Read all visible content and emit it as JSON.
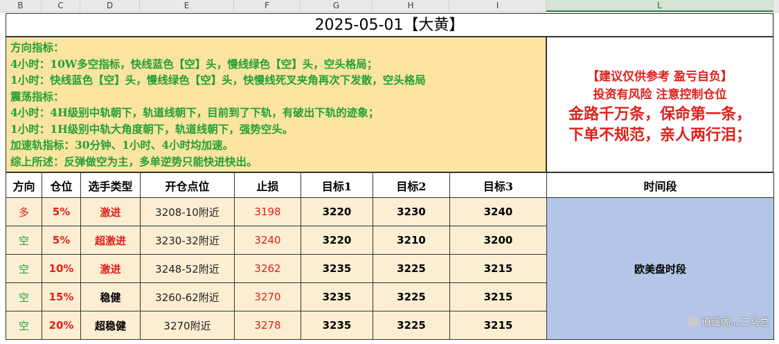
{
  "column_headers": [
    "B",
    "C",
    "D",
    "E",
    "F",
    "G",
    "H",
    "I",
    "L"
  ],
  "title": "2025-05-01【大黄】",
  "analysis_lines": [
    "方向指标：",
    "4小时：10W多空指标，快线蓝色【空】头，慢线绿色【空】头，空头格局；",
    "1小时：快线蓝色【空】头，慢线绿色【空】头，快慢线死叉夹角再次下发散，空头格局",
    "震荡指标：",
    "4小时：4H级别中轨朝下，轨道线朝下，目前到了下轨，有破出下轨的迹象；",
    "1小时：1H级别中轨大角度朝下，轨道线朝下，强势空头。",
    "加速轨指标：30分钟、1小时、4小时均加速。",
    "综上所述：反弹做空为主，多单逆势只能快进快出。"
  ],
  "risk_notes": [
    "【建议仅供参考 盈亏自负】",
    "投资有风险 注意控制仓位",
    "金路千万条，保命第一条，",
    "下单不规范，亲人两行泪；"
  ],
  "table": {
    "headers": [
      "方向",
      "仓位",
      "选手类型",
      "开仓点位",
      "止损",
      "目标1",
      "目标2",
      "目标3",
      "时间段"
    ],
    "rows": [
      {
        "direction": "多",
        "position": "5%",
        "type": "激进",
        "entry": "3208-10附近",
        "stop": "3198",
        "t1": "3220",
        "t2": "3230",
        "t3": "3240"
      },
      {
        "direction": "空",
        "position": "5%",
        "type": "超激进",
        "entry": "3230-32附近",
        "stop": "3240",
        "t1": "3220",
        "t2": "3210",
        "t3": "3200"
      },
      {
        "direction": "空",
        "position": "10%",
        "type": "激进",
        "entry": "3248-52附近",
        "stop": "3262",
        "t1": "3235",
        "t2": "3225",
        "t3": "3215"
      },
      {
        "direction": "空",
        "position": "15%",
        "type": "稳健",
        "entry": "3260-62附近",
        "stop": "3270",
        "t1": "3235",
        "t2": "3225",
        "t3": "3215"
      },
      {
        "direction": "空",
        "position": "20%",
        "type": "超稳健",
        "entry": "3270附近",
        "stop": "3278",
        "t1": "3235",
        "t2": "3225",
        "t3": "3215"
      }
    ],
    "session": "欧美盘时段"
  },
  "watermark": "道遥阁灬二马总",
  "colors": {
    "info_bg": "#fbe3a0",
    "row_bg": "#fbeed2",
    "session_bg": "#b4c6e7",
    "red": "#e0201b",
    "green": "#22a037"
  }
}
